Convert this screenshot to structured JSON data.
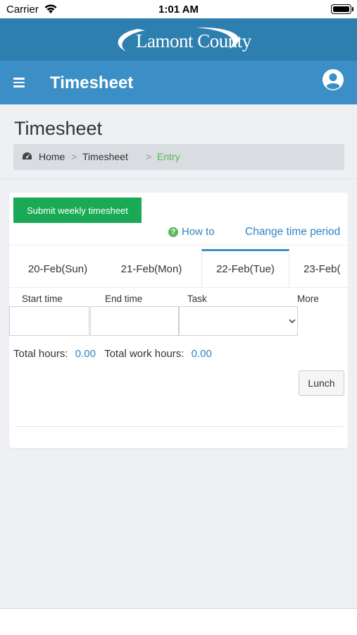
{
  "status_bar": {
    "carrier": "Carrier",
    "time": "1:01 AM"
  },
  "brand": {
    "logo_text": "Lamont County"
  },
  "nav": {
    "title": "Timesheet"
  },
  "page": {
    "title": "Timesheet",
    "breadcrumb": {
      "home": "Home",
      "separator": ">",
      "timesheet": "Timesheet",
      "current": "Entry"
    }
  },
  "card": {
    "submit_label": "Submit weekly timesheet",
    "how_to_label": "How to",
    "change_period_label": "Change time period",
    "tabs": [
      {
        "label": "20-Feb(Sun)",
        "active": false
      },
      {
        "label": "21-Feb(Mon)",
        "active": false
      },
      {
        "label": "22-Feb(Tue)",
        "active": true
      },
      {
        "label": "23-Feb(",
        "active": false
      }
    ],
    "columns": {
      "start": "Start time",
      "end": "End time",
      "task": "Task",
      "more": "More"
    },
    "fields": {
      "start_value": "",
      "end_value": "",
      "task_value": ""
    },
    "totals": {
      "total_label": "Total hours:",
      "total_value": "0.00",
      "work_label": "Total work hours:",
      "work_value": "0.00"
    },
    "lunch_label": "Lunch"
  },
  "colors": {
    "brand_bar": "#2d7fb0",
    "nav_bar": "#3b8fc6",
    "submit": "#1aaa55",
    "link": "#2e86c1",
    "breadcrumb_current": "#5cb85c"
  },
  "icons": [
    "wifi-icon",
    "battery-icon",
    "menu-icon",
    "user-icon",
    "dashboard-icon",
    "help-icon",
    "chevron-down-icon"
  ]
}
